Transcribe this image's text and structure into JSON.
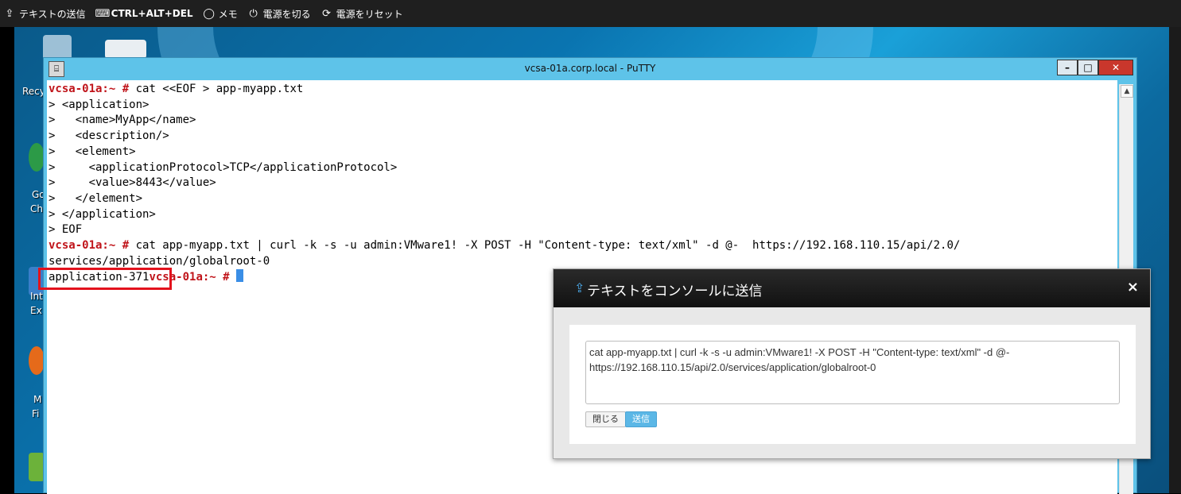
{
  "toolbar": {
    "items": [
      {
        "label": "テキストの送信",
        "icon": "share-icon"
      },
      {
        "label": "CTRL+ALT+DEL",
        "icon": "keyboard-icon"
      },
      {
        "label": "メモ",
        "icon": "speech-bubble-icon"
      },
      {
        "label": "電源を切る",
        "icon": "power-icon"
      },
      {
        "label": "電源をリセット",
        "icon": "refresh-icon"
      }
    ]
  },
  "desktop": {
    "labels": [
      "Recy",
      "Go",
      "Ch",
      "Int",
      "Ex",
      "M",
      "Fi"
    ]
  },
  "putty": {
    "title": "vcsa-01a.corp.local - PuTTY",
    "prompt": "vcsa-01a:~ #",
    "lines": [
      {
        "prompt": true,
        "text": " cat <<EOF > app-myapp.txt"
      },
      {
        "prompt": false,
        "text": "> <application>"
      },
      {
        "prompt": false,
        "text": ">   <name>MyApp</name>"
      },
      {
        "prompt": false,
        "text": ">   <description/>"
      },
      {
        "prompt": false,
        "text": ">   <element>"
      },
      {
        "prompt": false,
        "text": ">     <applicationProtocol>TCP</applicationProtocol>"
      },
      {
        "prompt": false,
        "text": ">     <value>8443</value>"
      },
      {
        "prompt": false,
        "text": ">   </element>"
      },
      {
        "prompt": false,
        "text": "> </application>"
      },
      {
        "prompt": false,
        "text": "> EOF"
      },
      {
        "prompt": true,
        "text": " cat app-myapp.txt | curl -k -s -u admin:VMware1! -X POST -H \"Content-type: text/xml\" -d @-  https://192.168.110.15/api/2.0/"
      },
      {
        "prompt": false,
        "text": "services/application/globalroot-0"
      }
    ],
    "result_line": "application-371",
    "result_prompt": "vcsa-01a:~ #"
  },
  "dialog": {
    "title": "テキストをコンソールに送信",
    "text": "cat app-myapp.txt | curl -k -s -u admin:VMware1! -X POST -H \"Content-type: text/xml\" -d @- https://192.168.110.15/api/2.0/services/application/globalroot-0",
    "cancel_label": "閉じる",
    "send_label": "送信"
  }
}
